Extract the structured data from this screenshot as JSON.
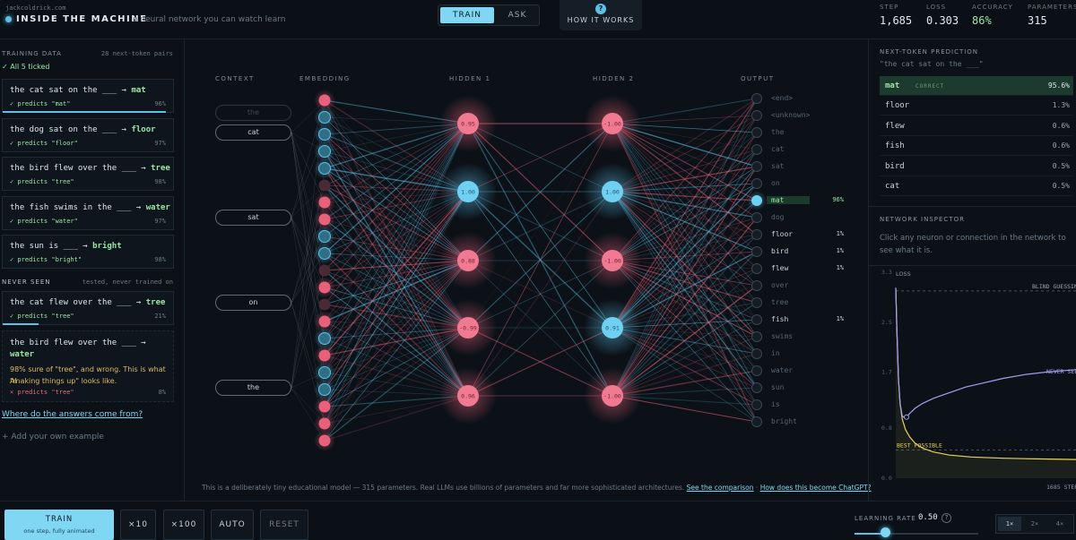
{
  "header": {
    "url": "jackcoldrick.com",
    "title": "INSIDE THE MACHINE",
    "tagline": "a neural network you can watch learn",
    "tabs": {
      "train": "TRAIN",
      "ask": "ASK"
    },
    "how_it_works": {
      "icon": "?",
      "label": "HOW IT WORKS"
    },
    "stats": [
      {
        "label": "STEP",
        "value": "1,685"
      },
      {
        "label": "LOSS",
        "value": "0.303"
      },
      {
        "label": "ACCURACY",
        "value": "86%"
      },
      {
        "label": "PARAMETERS",
        "value": "315"
      }
    ]
  },
  "sidebar": {
    "training_title": "TRAINING DATA",
    "training_count": "28 next-token pairs",
    "ticked": "✓ All 5 ticked",
    "training": [
      {
        "prompt": "the cat sat on the ___ →",
        "answer": "mat",
        "predicts": "✓ predicts \"mat\"",
        "pct": "96%",
        "bar": 0.96
      },
      {
        "prompt": "the dog sat on the ___ →",
        "answer": "floor",
        "predicts": "✓ predicts \"floor\"",
        "pct": "97%",
        "bar": 0.97
      },
      {
        "prompt": "the bird flew over the ___ →",
        "answer": "tree",
        "predicts": "✓ predicts \"tree\"",
        "pct": "98%",
        "bar": 0.98
      },
      {
        "prompt": "the fish swims in the ___ →",
        "answer": "water",
        "predicts": "✓ predicts \"water\"",
        "pct": "97%",
        "bar": 0.97
      },
      {
        "prompt": "the sun is ___ →",
        "answer": "bright",
        "predicts": "✓ predicts \"bright\"",
        "pct": "98%",
        "bar": 0.98
      }
    ],
    "never_title": "NEVER SEEN",
    "never_note": "tested, never trained on",
    "never": [
      {
        "prompt": "the cat flew over the ___ →",
        "answer": "tree",
        "predicts": "✓ predicts \"tree\"",
        "pct": "21%",
        "bar": 0.21
      },
      {
        "prompt": "the bird flew over the ___ →",
        "answer": "water",
        "note_1": "98% sure of \"tree\", and wrong. This is what AI",
        "note_2": "\"making things up\" looks like.",
        "predicts": "× predicts \"tree\"",
        "pct": "8%"
      }
    ],
    "where_link": "Where do the answers come from?",
    "add_own": "+ Add your own example"
  },
  "network": {
    "columns": [
      "CONTEXT",
      "EMBEDDING",
      "HIDDEN 1",
      "HIDDEN 2",
      "OUTPUT"
    ],
    "context": [
      "the",
      "cat",
      "sat",
      "on",
      "the"
    ],
    "hidden1": [
      "0.95",
      "1.00",
      "0.88",
      "-0.99",
      "0.96"
    ],
    "hidden2": [
      "-1.00",
      "1.00",
      "-1.00",
      "0.91",
      "-1.00"
    ],
    "hidden1_sign": [
      "pos",
      "neg",
      "pos",
      "pos",
      "pos"
    ],
    "hidden2_sign": [
      "pos",
      "neg",
      "pos",
      "neg",
      "pos"
    ],
    "embedding_colors": [
      "pink",
      "blue",
      "blue",
      "blue",
      "blue",
      "dim",
      "pink",
      "pink",
      "blue",
      "blue",
      "dim",
      "pink",
      "dim",
      "pink",
      "blue",
      "pink",
      "blue",
      "blue",
      "pink",
      "pink",
      "pink"
    ],
    "outputs": [
      {
        "word": "<end>",
        "pct": ""
      },
      {
        "word": "<unknown>",
        "pct": ""
      },
      {
        "word": "the",
        "pct": ""
      },
      {
        "word": "cat",
        "pct": ""
      },
      {
        "word": "sat",
        "pct": ""
      },
      {
        "word": "on",
        "pct": ""
      },
      {
        "word": "mat",
        "pct": "96%",
        "best": true
      },
      {
        "word": "dog",
        "pct": ""
      },
      {
        "word": "floor",
        "pct": "1%"
      },
      {
        "word": "bird",
        "pct": "1%"
      },
      {
        "word": "flew",
        "pct": "1%"
      },
      {
        "word": "over",
        "pct": ""
      },
      {
        "word": "tree",
        "pct": ""
      },
      {
        "word": "fish",
        "pct": "1%"
      },
      {
        "word": "swims",
        "pct": ""
      },
      {
        "word": "in",
        "pct": ""
      },
      {
        "word": "water",
        "pct": ""
      },
      {
        "word": "sun",
        "pct": ""
      },
      {
        "word": "is",
        "pct": ""
      },
      {
        "word": "bright",
        "pct": ""
      }
    ],
    "footnote_text": "This is a deliberately tiny educational model — 315 parameters. Real LLMs use billions of parameters and far more sophisticated architectures.",
    "footnote_link1": "See the comparison",
    "footnote_sep": " · ",
    "footnote_link2": "How does this become ChatGPT?"
  },
  "right": {
    "pred_title": "NEXT-TOKEN PREDICTION",
    "pred_query": "\"the cat sat on the ___\"",
    "predictions": [
      {
        "word": "mat",
        "tag": "CORRECT",
        "pct": "95.6%"
      },
      {
        "word": "floor",
        "tag": "",
        "pct": "1.3%"
      },
      {
        "word": "flew",
        "tag": "",
        "pct": "0.6%"
      },
      {
        "word": "fish",
        "tag": "",
        "pct": "0.6%"
      },
      {
        "word": "bird",
        "tag": "",
        "pct": "0.5%"
      },
      {
        "word": "cat",
        "tag": "",
        "pct": "0.5%"
      }
    ],
    "inspector_title": "NETWORK INSPECTOR",
    "inspector_text": "Click any neuron or connection in the network to see what it is."
  },
  "chart_data": {
    "type": "line",
    "title": "",
    "ylabel": "LOSS",
    "xlabel": "",
    "yticks": [
      "3.3",
      "2.5",
      "1.7",
      "0.8",
      "0.0"
    ],
    "ylim": [
      0,
      3.3
    ],
    "x_end_label": "1685 STEPS",
    "annotations": {
      "blind": "BLIND GUESSING",
      "best": "BEST POSSIBLE",
      "never": "NEVER SEEN"
    },
    "series": [
      {
        "name": "training loss",
        "color": "#e8d35a",
        "x": [
          0,
          10,
          25,
          40,
          60,
          90,
          130,
          180,
          250,
          350,
          500,
          700,
          1000,
          1300,
          1685
        ],
        "y": [
          3.05,
          2.4,
          1.6,
          1.2,
          0.95,
          0.78,
          0.66,
          0.56,
          0.48,
          0.42,
          0.37,
          0.34,
          0.32,
          0.31,
          0.3
        ]
      },
      {
        "name": "never seen",
        "color": "#a99cf0",
        "x": [
          0,
          10,
          25,
          40,
          60,
          80,
          100,
          130,
          180,
          250,
          350,
          450,
          550,
          650,
          800,
          1000,
          1200,
          1400,
          1685
        ],
        "y": [
          3.05,
          2.4,
          1.6,
          1.2,
          1.0,
          0.97,
          0.98,
          1.04,
          1.12,
          1.2,
          1.28,
          1.34,
          1.4,
          1.46,
          1.52,
          1.6,
          1.66,
          1.7,
          1.74
        ]
      }
    ],
    "reference_lines": {
      "blind": 3.0,
      "best": 0.45
    },
    "xlim": [
      0,
      1685
    ]
  },
  "bottom": {
    "train_label": "TRAIN",
    "train_sub": "one step, fully animated",
    "x10": "×10",
    "x100": "×100",
    "auto": "AUTO",
    "reset": "RESET",
    "lr_label": "LEARNING RATE",
    "lr_value": "0.50",
    "lr_help": "?",
    "lr_fraction": 0.25,
    "speeds": [
      "1×",
      "2×",
      "4×"
    ]
  },
  "colors": {
    "accent": "#7fd7f3",
    "positive": "#e8607a",
    "negative": "#5fc0e6",
    "correct": "#9be5a6",
    "warning": "#e0b868"
  }
}
